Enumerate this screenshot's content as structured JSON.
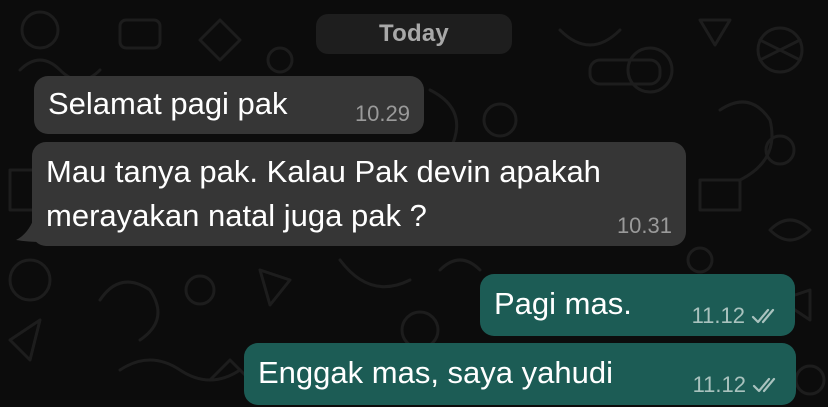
{
  "date_chip": "Today",
  "messages": [
    {
      "direction": "incoming",
      "text": "Selamat pagi pak",
      "time": "10.29"
    },
    {
      "direction": "incoming",
      "text": "Mau tanya pak. Kalau Pak devin apakah\nmerayakan natal juga pak ?",
      "time": "10.31"
    },
    {
      "direction": "outgoing",
      "text": "Pagi mas.",
      "time": "11.12",
      "status_icon": "double-check-icon"
    },
    {
      "direction": "outgoing",
      "text": "Enggak mas, saya yahudi",
      "time": "11.12",
      "status_icon": "double-check-icon"
    }
  ],
  "colors": {
    "background": "#0c0c0c",
    "incoming_bubble": "#363636",
    "outgoing_bubble": "#1c5c55",
    "date_chip": "#1e1e1e"
  }
}
